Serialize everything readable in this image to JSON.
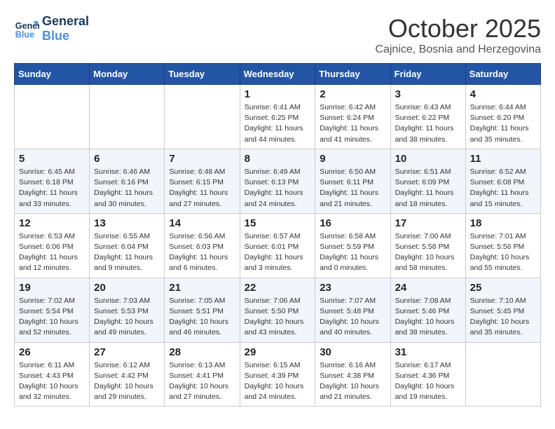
{
  "header": {
    "logo_line1": "General",
    "logo_line2": "Blue",
    "month": "October 2025",
    "location": "Cajnice, Bosnia and Herzegovina"
  },
  "weekdays": [
    "Sunday",
    "Monday",
    "Tuesday",
    "Wednesday",
    "Thursday",
    "Friday",
    "Saturday"
  ],
  "weeks": [
    [
      {
        "day": "",
        "info": ""
      },
      {
        "day": "",
        "info": ""
      },
      {
        "day": "",
        "info": ""
      },
      {
        "day": "1",
        "info": "Sunrise: 6:41 AM\nSunset: 6:25 PM\nDaylight: 11 hours\nand 44 minutes."
      },
      {
        "day": "2",
        "info": "Sunrise: 6:42 AM\nSunset: 6:24 PM\nDaylight: 11 hours\nand 41 minutes."
      },
      {
        "day": "3",
        "info": "Sunrise: 6:43 AM\nSunset: 6:22 PM\nDaylight: 11 hours\nand 38 minutes."
      },
      {
        "day": "4",
        "info": "Sunrise: 6:44 AM\nSunset: 6:20 PM\nDaylight: 11 hours\nand 35 minutes."
      }
    ],
    [
      {
        "day": "5",
        "info": "Sunrise: 6:45 AM\nSunset: 6:18 PM\nDaylight: 11 hours\nand 33 minutes."
      },
      {
        "day": "6",
        "info": "Sunrise: 6:46 AM\nSunset: 6:16 PM\nDaylight: 11 hours\nand 30 minutes."
      },
      {
        "day": "7",
        "info": "Sunrise: 6:48 AM\nSunset: 6:15 PM\nDaylight: 11 hours\nand 27 minutes."
      },
      {
        "day": "8",
        "info": "Sunrise: 6:49 AM\nSunset: 6:13 PM\nDaylight: 11 hours\nand 24 minutes."
      },
      {
        "day": "9",
        "info": "Sunrise: 6:50 AM\nSunset: 6:11 PM\nDaylight: 11 hours\nand 21 minutes."
      },
      {
        "day": "10",
        "info": "Sunrise: 6:51 AM\nSunset: 6:09 PM\nDaylight: 11 hours\nand 18 minutes."
      },
      {
        "day": "11",
        "info": "Sunrise: 6:52 AM\nSunset: 6:08 PM\nDaylight: 11 hours\nand 15 minutes."
      }
    ],
    [
      {
        "day": "12",
        "info": "Sunrise: 6:53 AM\nSunset: 6:06 PM\nDaylight: 11 hours\nand 12 minutes."
      },
      {
        "day": "13",
        "info": "Sunrise: 6:55 AM\nSunset: 6:04 PM\nDaylight: 11 hours\nand 9 minutes."
      },
      {
        "day": "14",
        "info": "Sunrise: 6:56 AM\nSunset: 6:03 PM\nDaylight: 11 hours\nand 6 minutes."
      },
      {
        "day": "15",
        "info": "Sunrise: 6:57 AM\nSunset: 6:01 PM\nDaylight: 11 hours\nand 3 minutes."
      },
      {
        "day": "16",
        "info": "Sunrise: 6:58 AM\nSunset: 5:59 PM\nDaylight: 11 hours\nand 0 minutes."
      },
      {
        "day": "17",
        "info": "Sunrise: 7:00 AM\nSunset: 5:58 PM\nDaylight: 10 hours\nand 58 minutes."
      },
      {
        "day": "18",
        "info": "Sunrise: 7:01 AM\nSunset: 5:56 PM\nDaylight: 10 hours\nand 55 minutes."
      }
    ],
    [
      {
        "day": "19",
        "info": "Sunrise: 7:02 AM\nSunset: 5:54 PM\nDaylight: 10 hours\nand 52 minutes."
      },
      {
        "day": "20",
        "info": "Sunrise: 7:03 AM\nSunset: 5:53 PM\nDaylight: 10 hours\nand 49 minutes."
      },
      {
        "day": "21",
        "info": "Sunrise: 7:05 AM\nSunset: 5:51 PM\nDaylight: 10 hours\nand 46 minutes."
      },
      {
        "day": "22",
        "info": "Sunrise: 7:06 AM\nSunset: 5:50 PM\nDaylight: 10 hours\nand 43 minutes."
      },
      {
        "day": "23",
        "info": "Sunrise: 7:07 AM\nSunset: 5:48 PM\nDaylight: 10 hours\nand 40 minutes."
      },
      {
        "day": "24",
        "info": "Sunrise: 7:08 AM\nSunset: 5:46 PM\nDaylight: 10 hours\nand 38 minutes."
      },
      {
        "day": "25",
        "info": "Sunrise: 7:10 AM\nSunset: 5:45 PM\nDaylight: 10 hours\nand 35 minutes."
      }
    ],
    [
      {
        "day": "26",
        "info": "Sunrise: 6:11 AM\nSunset: 4:43 PM\nDaylight: 10 hours\nand 32 minutes."
      },
      {
        "day": "27",
        "info": "Sunrise: 6:12 AM\nSunset: 4:42 PM\nDaylight: 10 hours\nand 29 minutes."
      },
      {
        "day": "28",
        "info": "Sunrise: 6:13 AM\nSunset: 4:41 PM\nDaylight: 10 hours\nand 27 minutes."
      },
      {
        "day": "29",
        "info": "Sunrise: 6:15 AM\nSunset: 4:39 PM\nDaylight: 10 hours\nand 24 minutes."
      },
      {
        "day": "30",
        "info": "Sunrise: 6:16 AM\nSunset: 4:38 PM\nDaylight: 10 hours\nand 21 minutes."
      },
      {
        "day": "31",
        "info": "Sunrise: 6:17 AM\nSunset: 4:36 PM\nDaylight: 10 hours\nand 19 minutes."
      },
      {
        "day": "",
        "info": ""
      }
    ]
  ]
}
